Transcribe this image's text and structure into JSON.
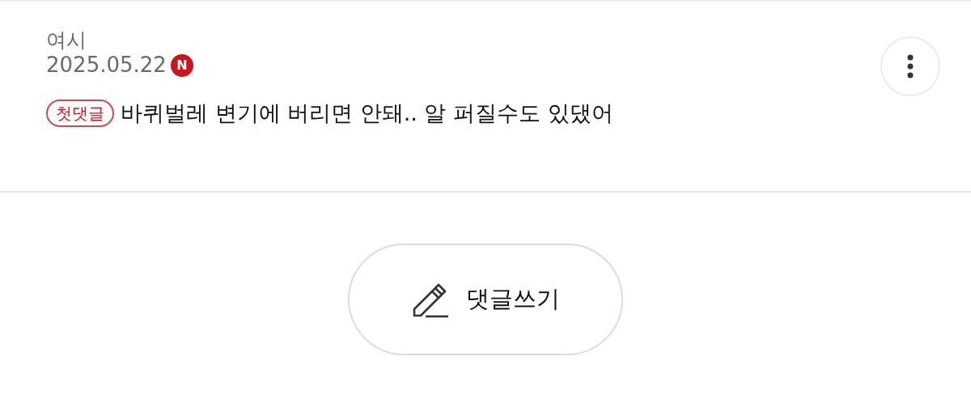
{
  "comment": {
    "author": "여시",
    "date": "2025.05.22",
    "new_badge": "N",
    "tag": "첫댓글",
    "text": "바퀴벌레 변기에 버리면 안돼.. 알 퍼질수도 있댔어"
  },
  "write_button": {
    "label": "댓글쓰기"
  }
}
